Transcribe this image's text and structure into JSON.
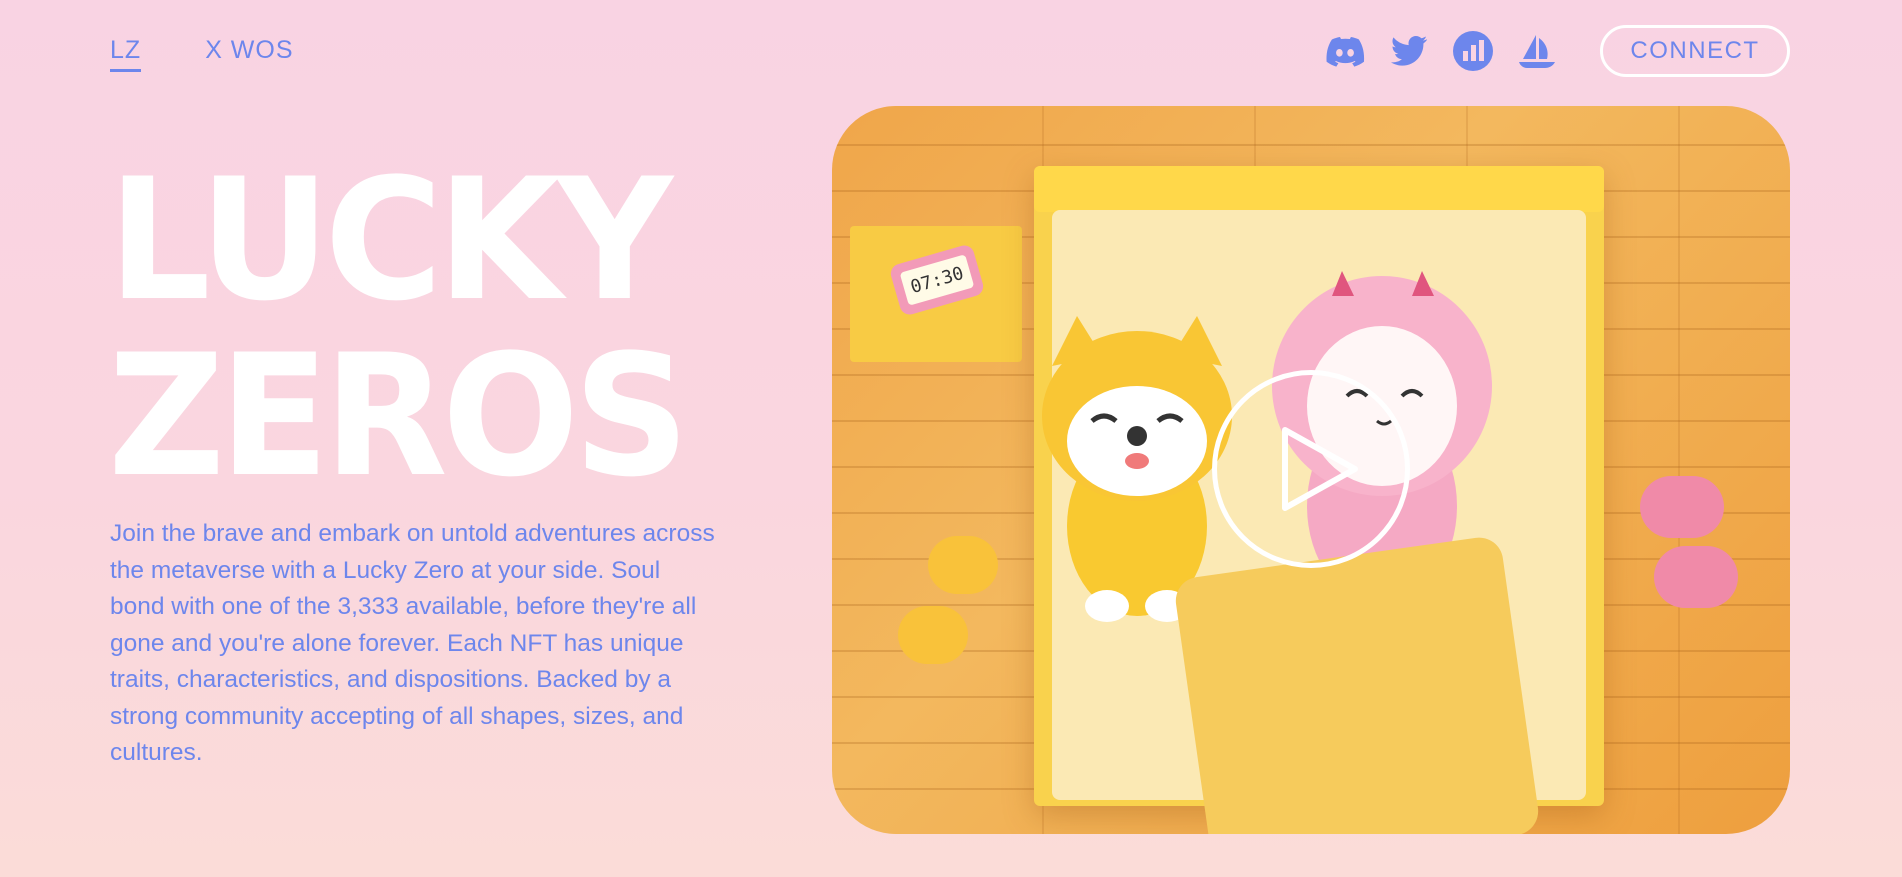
{
  "nav": {
    "links": [
      {
        "label": "LZ",
        "active": true
      },
      {
        "label": "X WOS",
        "active": false
      }
    ],
    "social": [
      "discord-icon",
      "twitter-icon",
      "coinmarket-chart-icon",
      "opensea-boat-icon"
    ],
    "connect_label": "CONNECT"
  },
  "hero": {
    "title_line1": "LUCKY",
    "title_line2": "ZEROS",
    "description": "Join the brave and embark on untold adventures across the metaverse with a Lucky Zero at your side. Soul bond with one of the 3,333 available, before they're all gone and you're alone forever. Each NFT has unique traits, characteristics, and dispositions. Backed by a strong community accepting of all shapes, sizes, and cultures."
  },
  "media": {
    "clock_time": "07:30",
    "play_icon": "play-icon"
  },
  "colors": {
    "accent": "#6d86ec",
    "background_top": "#f9d3e3",
    "background_bottom": "#fbdcd8",
    "title": "#ffffff"
  }
}
